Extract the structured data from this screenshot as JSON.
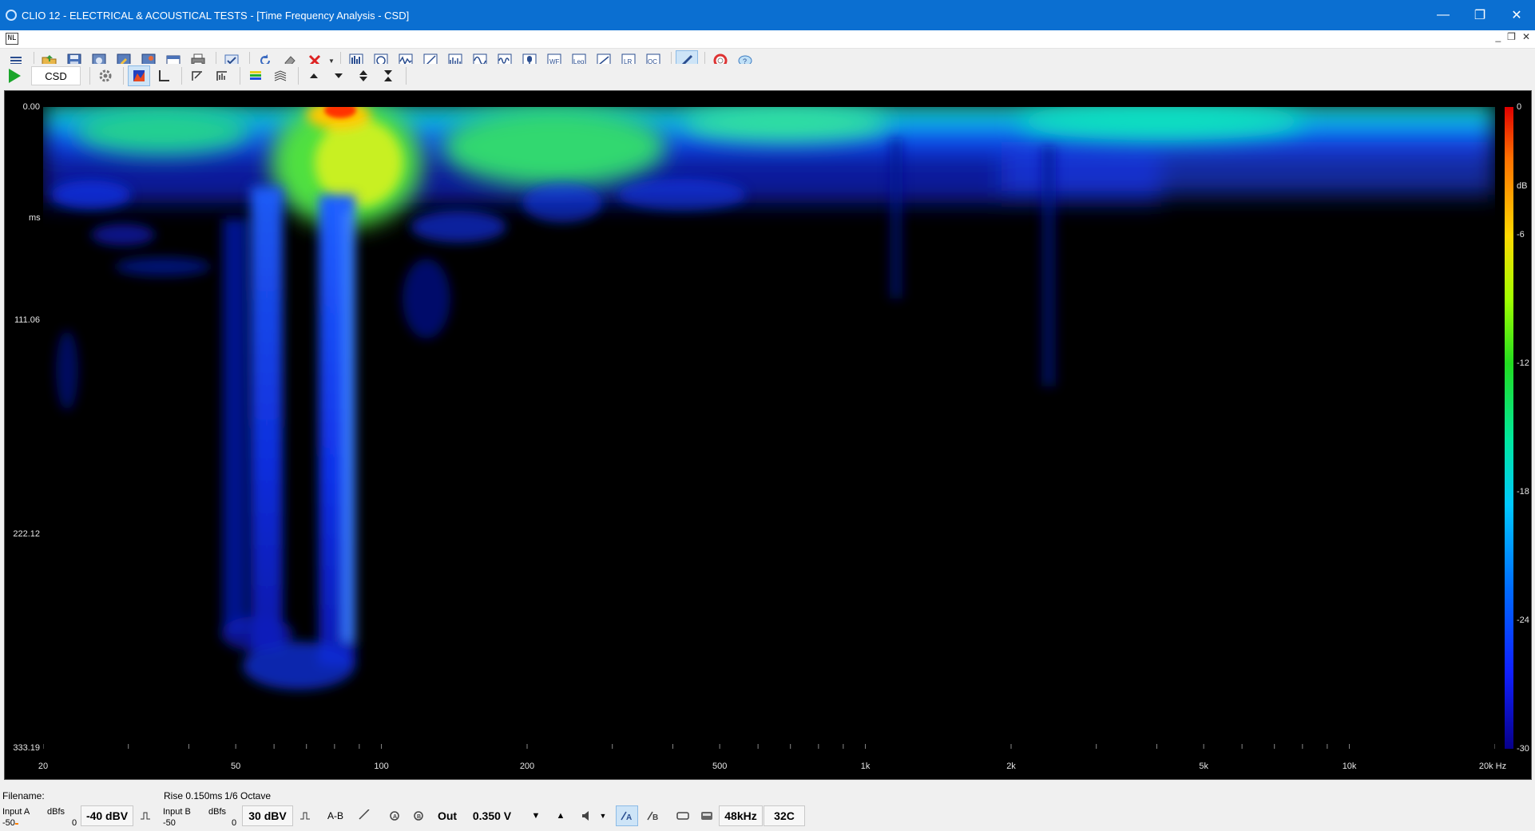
{
  "window": {
    "title": "CLIO 12 - ELECTRICAL & ACOUSTICAL TESTS - [Time Frequency Analysis - CSD]",
    "controls": [
      "—",
      "❐",
      "✕"
    ],
    "mdi_controls": [
      "_",
      "❐",
      "✕"
    ],
    "doc_icon_text": "NL"
  },
  "toolbar2": {
    "mode_label": "CSD"
  },
  "plot": {
    "y_unit": "ms",
    "y_ticks": [
      "0.00",
      "111.06",
      "222.12",
      "333.19"
    ],
    "x_ticks": [
      "20",
      "50",
      "100",
      "200",
      "500",
      "1k",
      "2k",
      "5k",
      "10k",
      "20k Hz"
    ],
    "colorbar_unit": "dB",
    "colorbar_ticks": [
      "0",
      "-6",
      "-12",
      "-18",
      "-24",
      "-30"
    ]
  },
  "chart_data": {
    "type": "heatmap",
    "title": "",
    "xlabel": "Hz",
    "ylabel": "ms",
    "x_scale": "log",
    "xlim": [
      20,
      20000
    ],
    "ylim": [
      0,
      333.19
    ],
    "x_ticks": [
      20,
      50,
      100,
      200,
      500,
      1000,
      2000,
      5000,
      10000,
      20000
    ],
    "y_ticks": [
      0.0,
      111.06,
      222.12,
      333.19
    ],
    "colorbar": {
      "unit": "dB",
      "range": [
        -30,
        0
      ],
      "ticks": [
        0,
        -6,
        -12,
        -18,
        -24,
        -30
      ]
    },
    "features": [
      {
        "freq_hz": 85,
        "time_ms": 3,
        "level_db": 0
      },
      {
        "freq_hz": 80,
        "time_ms": 40,
        "level_db": -8
      },
      {
        "freq_hz": 210,
        "time_ms": 25,
        "level_db": -10
      },
      {
        "freq_hz": 88,
        "time_ms": 290,
        "level_db": -22
      },
      {
        "freq_hz": 55,
        "time_ms": 270,
        "level_db": -24
      },
      {
        "freq_hz": 1150,
        "time_ms": 100,
        "level_db": -27
      },
      {
        "freq_hz": 2300,
        "time_ms": 140,
        "level_db": -27
      }
    ]
  },
  "status": {
    "filename_label": "Filename:",
    "filename_value": "",
    "rise": "Rise 0.150ms",
    "octave": "1/6 Octave",
    "input_a_label": "Input A",
    "input_a_unit": "dBfs",
    "input_a_min": "-50",
    "input_a_max": "0",
    "input_a_range": "-40 dBV",
    "input_b_label": "Input B",
    "input_b_unit": "dBfs",
    "input_b_min": "-50",
    "input_b_max": "0",
    "input_b_range": "30 dBV",
    "ab_label": "A-B",
    "out_label": "Out",
    "out_value": "0.350 V",
    "sample_rate": "48kHz",
    "temperature": "32C",
    "level_a": 0.05
  },
  "colors": {
    "titlebar": "#0b6fd1",
    "plot_background": "#000000",
    "toolbar_background": "#f0f0f0"
  }
}
